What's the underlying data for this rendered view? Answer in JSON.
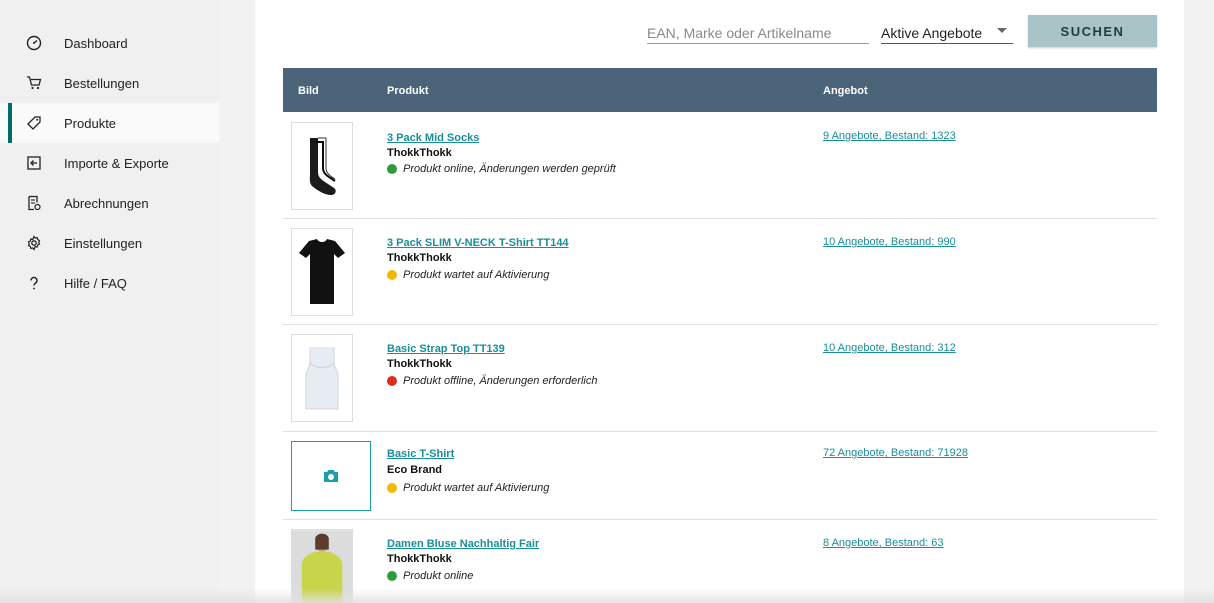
{
  "sidebar": {
    "items": [
      {
        "label": "Dashboard",
        "icon": "dashboard-gauge-icon"
      },
      {
        "label": "Bestellungen",
        "icon": "cart-icon"
      },
      {
        "label": "Produkte",
        "icon": "tag-icon",
        "active": true
      },
      {
        "label": "Importe & Exporte",
        "icon": "import-export-icon"
      },
      {
        "label": "Abrechnungen",
        "icon": "invoice-icon"
      },
      {
        "label": "Einstellungen",
        "icon": "gear-icon"
      },
      {
        "label": "Hilfe / FAQ",
        "icon": "question-icon"
      }
    ]
  },
  "search": {
    "placeholder": "EAN, Marke oder Artikelname",
    "value": "",
    "filter_value": "Aktive Angebote",
    "button_label": "SUCHEN"
  },
  "table": {
    "headers": {
      "image": "Bild",
      "product": "Produkt",
      "offer": "Angebot"
    },
    "rows": [
      {
        "name": "3 Pack Mid Socks",
        "brand": "ThokkThokk",
        "status": "Produkt online, Änderungen werden geprüft",
        "status_color": "#2e9a3b",
        "offer": "9 Angebote, Bestand: 1323",
        "thumb": "socks"
      },
      {
        "name": "3 Pack SLIM V-NECK T-Shirt TT144",
        "brand": "ThokkThokk",
        "status": "Produkt wartet auf Aktivierung",
        "status_color": "#f5b800",
        "offer": "10 Angebote, Bestand: 990",
        "thumb": "tshirt-black"
      },
      {
        "name": "Basic Strap Top TT139",
        "brand": "ThokkThokk",
        "status": "Produkt offline, Änderungen erforderlich",
        "status_color": "#e02b1b",
        "offer": "10 Angebote, Bestand: 312",
        "thumb": "top-white"
      },
      {
        "name": "Basic T-Shirt",
        "brand": "Eco Brand",
        "status": "Produkt wartet auf Aktivierung",
        "status_color": "#f5b800",
        "offer": "72 Angebote, Bestand: 71928",
        "thumb": "camera-placeholder"
      },
      {
        "name": "Damen Bluse Nachhaltig Fair",
        "brand": "ThokkThokk",
        "status": "Produkt online",
        "status_color": "#2e9a3b",
        "offer": "8 Angebote, Bestand: 63",
        "thumb": "blouse-lime"
      }
    ]
  },
  "colors": {
    "accent": "#1a8e99",
    "header_bg": "#4c6479",
    "button_bg": "#a9c4c7",
    "active_indicator": "#006b6b"
  }
}
